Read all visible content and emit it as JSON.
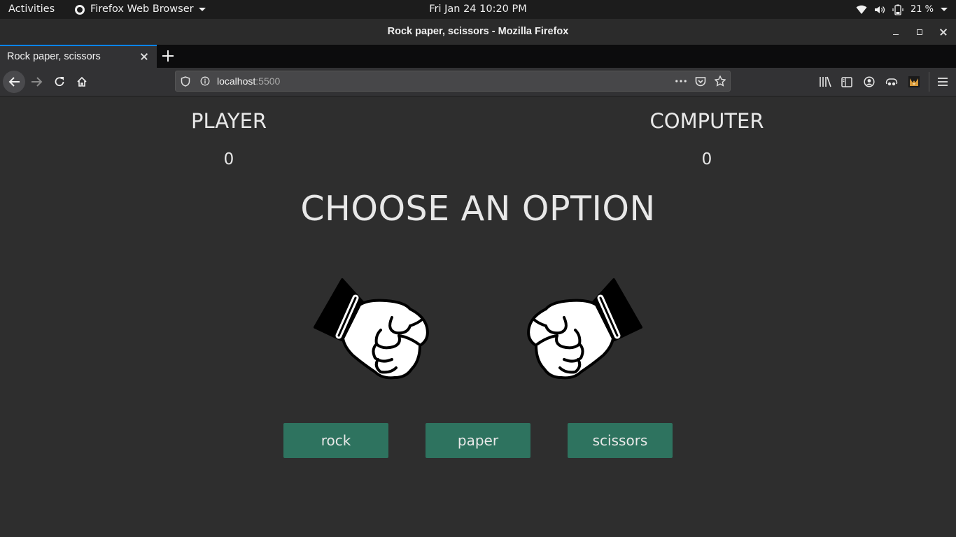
{
  "system_bar": {
    "activities": "Activities",
    "app_name": "Firefox Web Browser",
    "clock": "Fri Jan 24  10:20 PM",
    "battery": "21 %"
  },
  "window": {
    "title": "Rock paper, scissors - Mozilla Firefox"
  },
  "tabs": [
    {
      "label": "Rock paper, scissors",
      "active": true
    }
  ],
  "navigation": {
    "url_host": "localhost",
    "url_port": ":5500"
  },
  "game": {
    "player_label": "PLAYER",
    "computer_label": "COMPUTER",
    "player_score": "0",
    "computer_score": "0",
    "heading": "CHOOSE AN OPTION",
    "options": [
      "rock",
      "paper",
      "scissors"
    ],
    "player_hand_icon": "fist-icon",
    "computer_hand_icon": "fist-icon",
    "button_color": "#2e735f",
    "background_color": "#2e2e2e"
  }
}
